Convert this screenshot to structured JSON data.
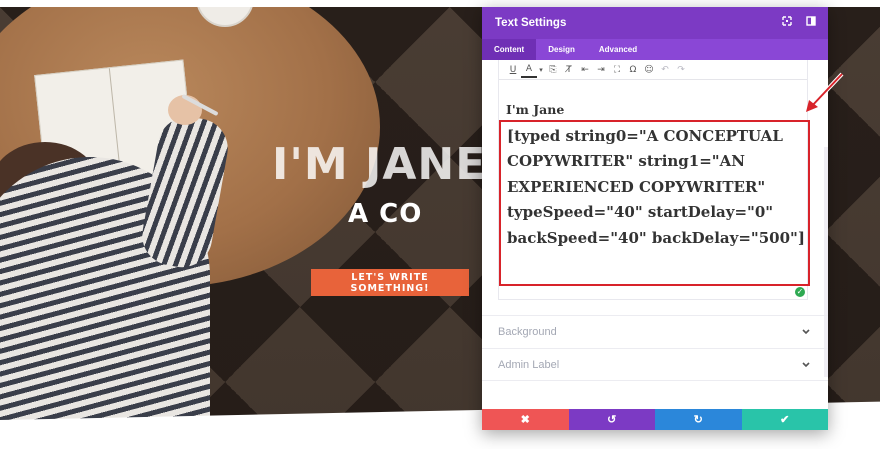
{
  "hero": {
    "title": "I'M JANE",
    "subtitle": "A CO",
    "cta_label": "LET'S WRITE SOMETHING!"
  },
  "modal": {
    "title": "Text Settings",
    "header_icons": [
      "expand-icon",
      "split-view-icon"
    ],
    "tabs": [
      {
        "label": "Content",
        "active": true
      },
      {
        "label": "Design",
        "active": false
      },
      {
        "label": "Advanced",
        "active": false
      }
    ],
    "toolbar": {
      "buttons": [
        {
          "name": "underline-icon",
          "glyph": "U"
        },
        {
          "name": "text-color-icon",
          "glyph": "A"
        },
        {
          "name": "color-dropdown-icon",
          "glyph": "▾"
        },
        {
          "name": "paste-text-icon",
          "glyph": "⎘"
        },
        {
          "name": "clear-formatting-icon",
          "glyph": "T̸"
        },
        {
          "name": "outdent-icon",
          "glyph": "⇤"
        },
        {
          "name": "indent-icon",
          "glyph": "⇥"
        },
        {
          "name": "fullscreen-icon",
          "glyph": "⛶"
        },
        {
          "name": "special-character-icon",
          "glyph": "Ω"
        },
        {
          "name": "emoji-icon",
          "glyph": "☺"
        },
        {
          "name": "undo-icon",
          "glyph": "↶"
        },
        {
          "name": "redo-icon",
          "glyph": "↷"
        }
      ]
    },
    "editor": {
      "heading": "I'm Jane",
      "shortcode": "[typed string0=\"A CONCEPTUAL COPYWRITER\" string1=\"AN EXPERIENCED COPYWRITER\" typeSpeed=\"40\" startDelay=\"0\" backSpeed=\"40\" backDelay=\"500\"]"
    },
    "sections": [
      {
        "label": "Background"
      },
      {
        "label": "Admin Label"
      }
    ],
    "footer": {
      "buttons": [
        {
          "name": "discard-button",
          "icon": "close-icon",
          "glyph": "✖",
          "color": "#ef5555"
        },
        {
          "name": "undo-button",
          "icon": "undo-icon",
          "glyph": "↺",
          "color": "#7c3ac4"
        },
        {
          "name": "redo-button",
          "icon": "redo-icon",
          "glyph": "↻",
          "color": "#2b87da"
        },
        {
          "name": "save-button",
          "icon": "check-icon",
          "glyph": "✔",
          "color": "#29c4a9"
        }
      ]
    }
  },
  "colors": {
    "header": "#7c3ac4",
    "tabs": "#8a47d6",
    "cta": "#e8633a",
    "highlight": "#d8232a"
  }
}
